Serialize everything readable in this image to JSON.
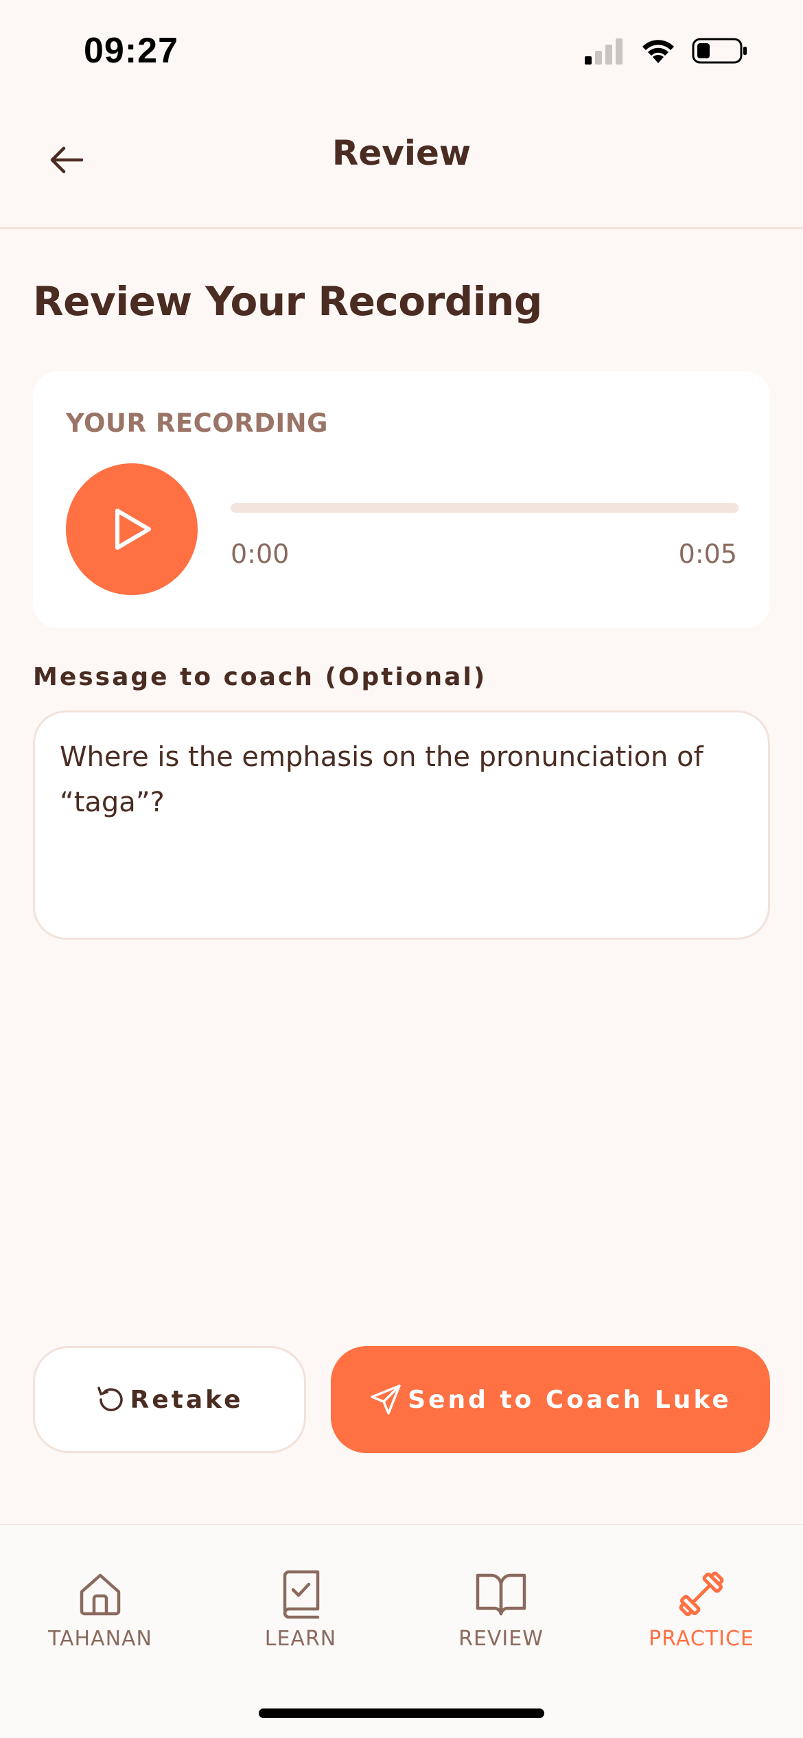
{
  "status_bar": {
    "time": "09:27"
  },
  "header": {
    "title": "Review"
  },
  "page": {
    "heading": "Review Your Recording"
  },
  "recording": {
    "label": "YOUR RECORDING",
    "current_time": "0:00",
    "duration": "0:05",
    "progress": 0
  },
  "message": {
    "label": "Message to coach (Optional)",
    "value": "Where is the emphasis on the pronunciation of “taga”?"
  },
  "actions": {
    "retake_label": "Retake",
    "send_label": "Send to Coach Luke"
  },
  "tabs": [
    {
      "label": "TAHANAN",
      "icon": "home-icon",
      "active": false
    },
    {
      "label": "LEARN",
      "icon": "book-check-icon",
      "active": false
    },
    {
      "label": "REVIEW",
      "icon": "open-book-icon",
      "active": false
    },
    {
      "label": "PRACTICE",
      "icon": "dumbbell-icon",
      "active": true
    }
  ],
  "colors": {
    "accent": "#FF7043",
    "background": "#FDF8F5",
    "text": "#4A2C22",
    "muted": "#8A6A5E"
  }
}
